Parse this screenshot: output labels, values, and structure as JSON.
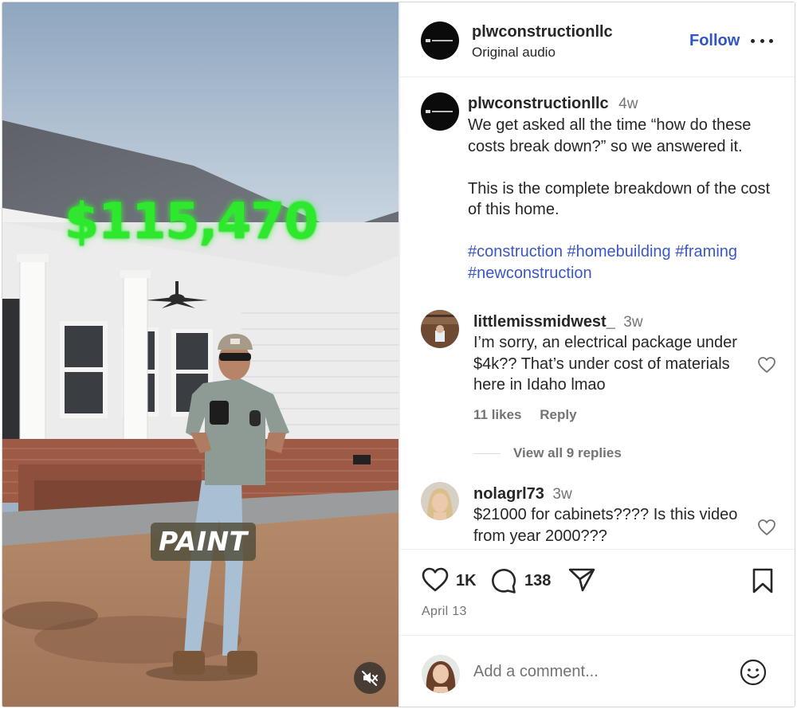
{
  "media": {
    "price_overlay": "$115,470",
    "caption_overlay": "PAINT",
    "mute_icon": "speaker-muted-icon"
  },
  "header": {
    "username": "plwconstructionllc",
    "audio": "Original audio",
    "follow_label": "Follow",
    "more_icon": "more-horizontal-icon"
  },
  "caption": {
    "username": "plwconstructionllc",
    "time": "4w",
    "line1": "We get asked all the time “how do these costs break down?” so we answered it.",
    "line2": "This is the complete breakdown of the cost of this home.",
    "hashtags": [
      "#construction",
      "#homebuilding",
      "#framing",
      "#newconstruction"
    ]
  },
  "comments": [
    {
      "username": "littlemissmidwest_",
      "time": "3w",
      "text": "I’m sorry, an electrical package under $4k?? That’s under cost of materials here in Idaho lmao",
      "likes": "11 likes",
      "reply_label": "Reply",
      "view_replies": "View all 9 replies"
    },
    {
      "username": "nolagrl73",
      "time": "3w",
      "text": "$21000 for cabinets???? Is this video from year 2000???"
    }
  ],
  "actions": {
    "like_count": "1K",
    "comment_count": "138",
    "date": "April 13"
  },
  "composer": {
    "placeholder": "Add a comment..."
  },
  "colors": {
    "accent_link": "#3a57c6",
    "follow": "#3255c5",
    "price_green": "#2ee82e",
    "secondary_text": "#737373"
  }
}
